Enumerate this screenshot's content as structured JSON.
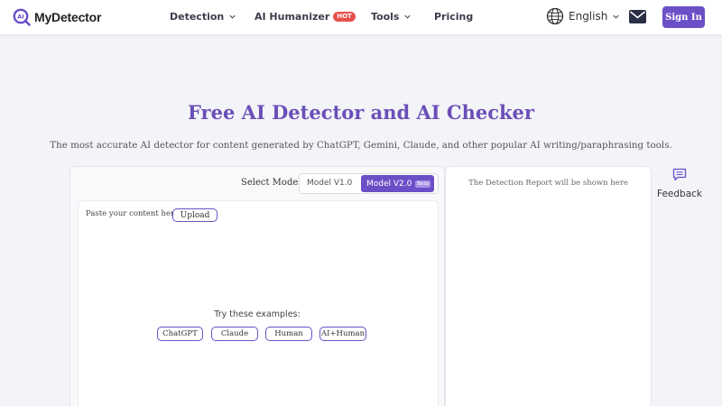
{
  "header": {
    "brand": "MyDetector",
    "logo_letters": "AI",
    "nav": [
      {
        "label": "Detection",
        "icon": "chevron-down-icon"
      },
      {
        "label": "AI Humanizer",
        "badge": "HOT"
      },
      {
        "label": "Tools",
        "icon": "chevron-down-icon"
      },
      {
        "label": "Pricing"
      }
    ],
    "language": "English",
    "sign_in": "Sign In"
  },
  "hero": {
    "title": "Free AI Detector and AI Checker",
    "subtitle": "The most accurate AI detector for content generated by ChatGPT, Gemini, Claude, and other popular AI writing/paraphrasing tools."
  },
  "detector": {
    "select_model_label": "Select Model:",
    "models": [
      {
        "label": "Model V1.0",
        "selected": false
      },
      {
        "label": "Model V2.0",
        "selected": true,
        "badge": "Beta"
      }
    ],
    "paste_prompt": "Paste your content here or",
    "upload_label": "Upload",
    "examples_label": "Try these examples:",
    "examples": [
      "ChatGPT",
      "Claude",
      "Human",
      "AI+Human"
    ]
  },
  "report": {
    "placeholder": "The Detection Report will be shown here"
  },
  "feedback": {
    "label": "Feedback",
    "icon": "chat-icon"
  },
  "colors": {
    "accent": "#6b4fc7",
    "title": "#6b4fb8",
    "hot": "#e8504a",
    "background": "#f3f4f8"
  }
}
